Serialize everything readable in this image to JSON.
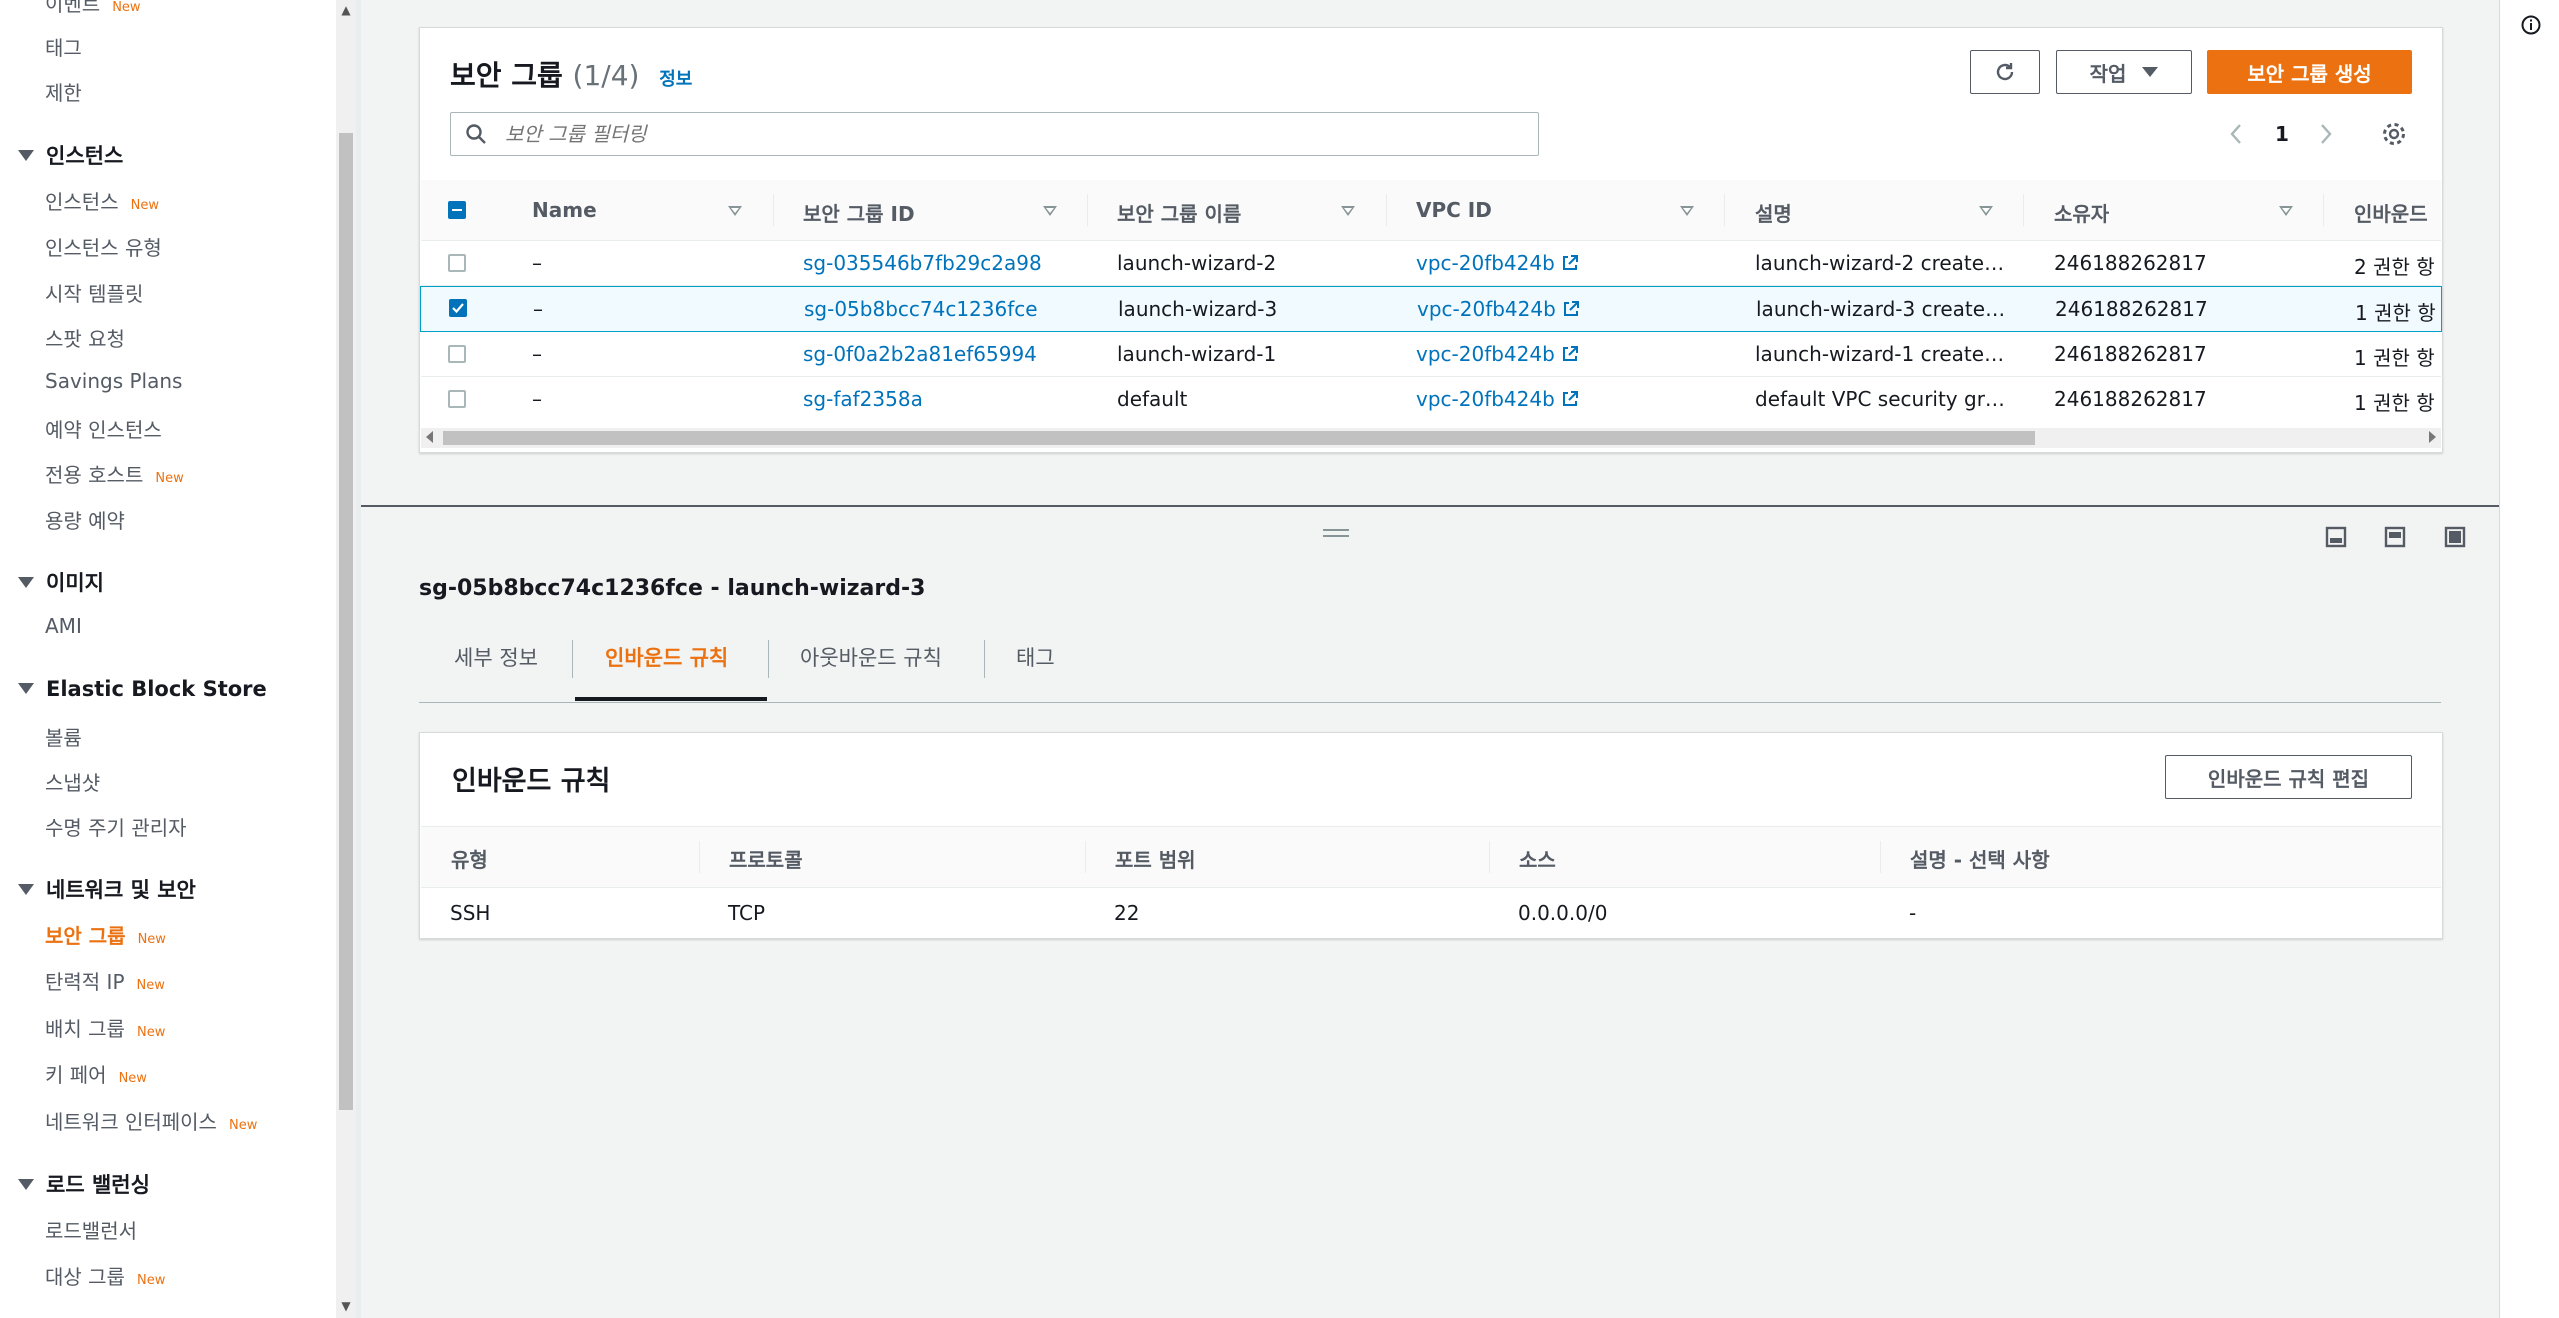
{
  "sidebar": {
    "top_partial": {
      "label": "이벤트",
      "badge": "New"
    },
    "top_items": [
      {
        "label": "태그"
      },
      {
        "label": "제한"
      }
    ],
    "sections": [
      {
        "title": "인스턴스",
        "items": [
          {
            "label": "인스턴스",
            "badge": "New"
          },
          {
            "label": "인스턴스 유형"
          },
          {
            "label": "시작 템플릿"
          },
          {
            "label": "스팟 요청"
          },
          {
            "label": "Savings Plans"
          },
          {
            "label": "예약 인스턴스"
          },
          {
            "label": "전용 호스트",
            "badge": "New"
          },
          {
            "label": "용량 예약"
          }
        ]
      },
      {
        "title": "이미지",
        "items": [
          {
            "label": "AMI"
          }
        ]
      },
      {
        "title": "Elastic Block Store",
        "items": [
          {
            "label": "볼륨"
          },
          {
            "label": "스냅샷"
          },
          {
            "label": "수명 주기 관리자"
          }
        ]
      },
      {
        "title": "네트워크 및 보안",
        "items": [
          {
            "label": "보안 그룹",
            "badge": "New"
          },
          {
            "label": "탄력적 IP",
            "badge": "New"
          },
          {
            "label": "배치 그룹",
            "badge": "New"
          },
          {
            "label": "키 페어",
            "badge": "New"
          },
          {
            "label": "네트워크 인터페이스",
            "badge": "New"
          }
        ]
      },
      {
        "title": "로드 밸런싱",
        "items": [
          {
            "label": "로드밸런서"
          },
          {
            "label": "대상 그룹",
            "badge": "New"
          }
        ]
      }
    ]
  },
  "security_groups": {
    "title": "보안 그룹",
    "count": "(1/4)",
    "info": "정보",
    "actions_label": "작업",
    "create_label": "보안 그룹 생성",
    "search_placeholder": "보안 그룹 필터링",
    "page": "1",
    "columns": [
      "Name",
      "보안 그룹 ID",
      "보안 그룹 이름",
      "VPC ID",
      "설명",
      "소유자",
      "인바운드"
    ],
    "rows": [
      {
        "name": "–",
        "id": "sg-035546b7fb29c2a98",
        "group_name": "launch-wizard-2",
        "vpc": "vpc-20fb424b",
        "desc": "launch-wizard-2 create…",
        "owner": "246188262817",
        "inbound": "2 권한 항"
      },
      {
        "name": "–",
        "id": "sg-05b8bcc74c1236fce",
        "group_name": "launch-wizard-3",
        "vpc": "vpc-20fb424b",
        "desc": "launch-wizard-3 create…",
        "owner": "246188262817",
        "inbound": "1 권한 항"
      },
      {
        "name": "–",
        "id": "sg-0f0a2b2a81ef65994",
        "group_name": "launch-wizard-1",
        "vpc": "vpc-20fb424b",
        "desc": "launch-wizard-1 create…",
        "owner": "246188262817",
        "inbound": "1 권한 항"
      },
      {
        "name": "–",
        "id": "sg-faf2358a",
        "group_name": "default",
        "vpc": "vpc-20fb424b",
        "desc": "default VPC security gr…",
        "owner": "246188262817",
        "inbound": "1 권한 항"
      }
    ]
  },
  "detail": {
    "title": "sg-05b8bcc74c1236fce - launch-wizard-3",
    "tabs": [
      "세부 정보",
      "인바운드 규칙",
      "아웃바운드 규칙",
      "태그"
    ],
    "rules_title": "인바운드 규칙",
    "edit_label": "인바운드 규칙 편집",
    "rule_columns": [
      "유형",
      "프로토콜",
      "포트 범위",
      "소스",
      "설명 - 선택 사항"
    ],
    "rules": [
      {
        "type": "SSH",
        "protocol": "TCP",
        "port": "22",
        "source": "0.0.0.0/0",
        "desc": "-"
      }
    ]
  },
  "colors": {
    "accent": "#ec7211",
    "link": "#0073bb",
    "selected_border": "#00a1c9"
  }
}
